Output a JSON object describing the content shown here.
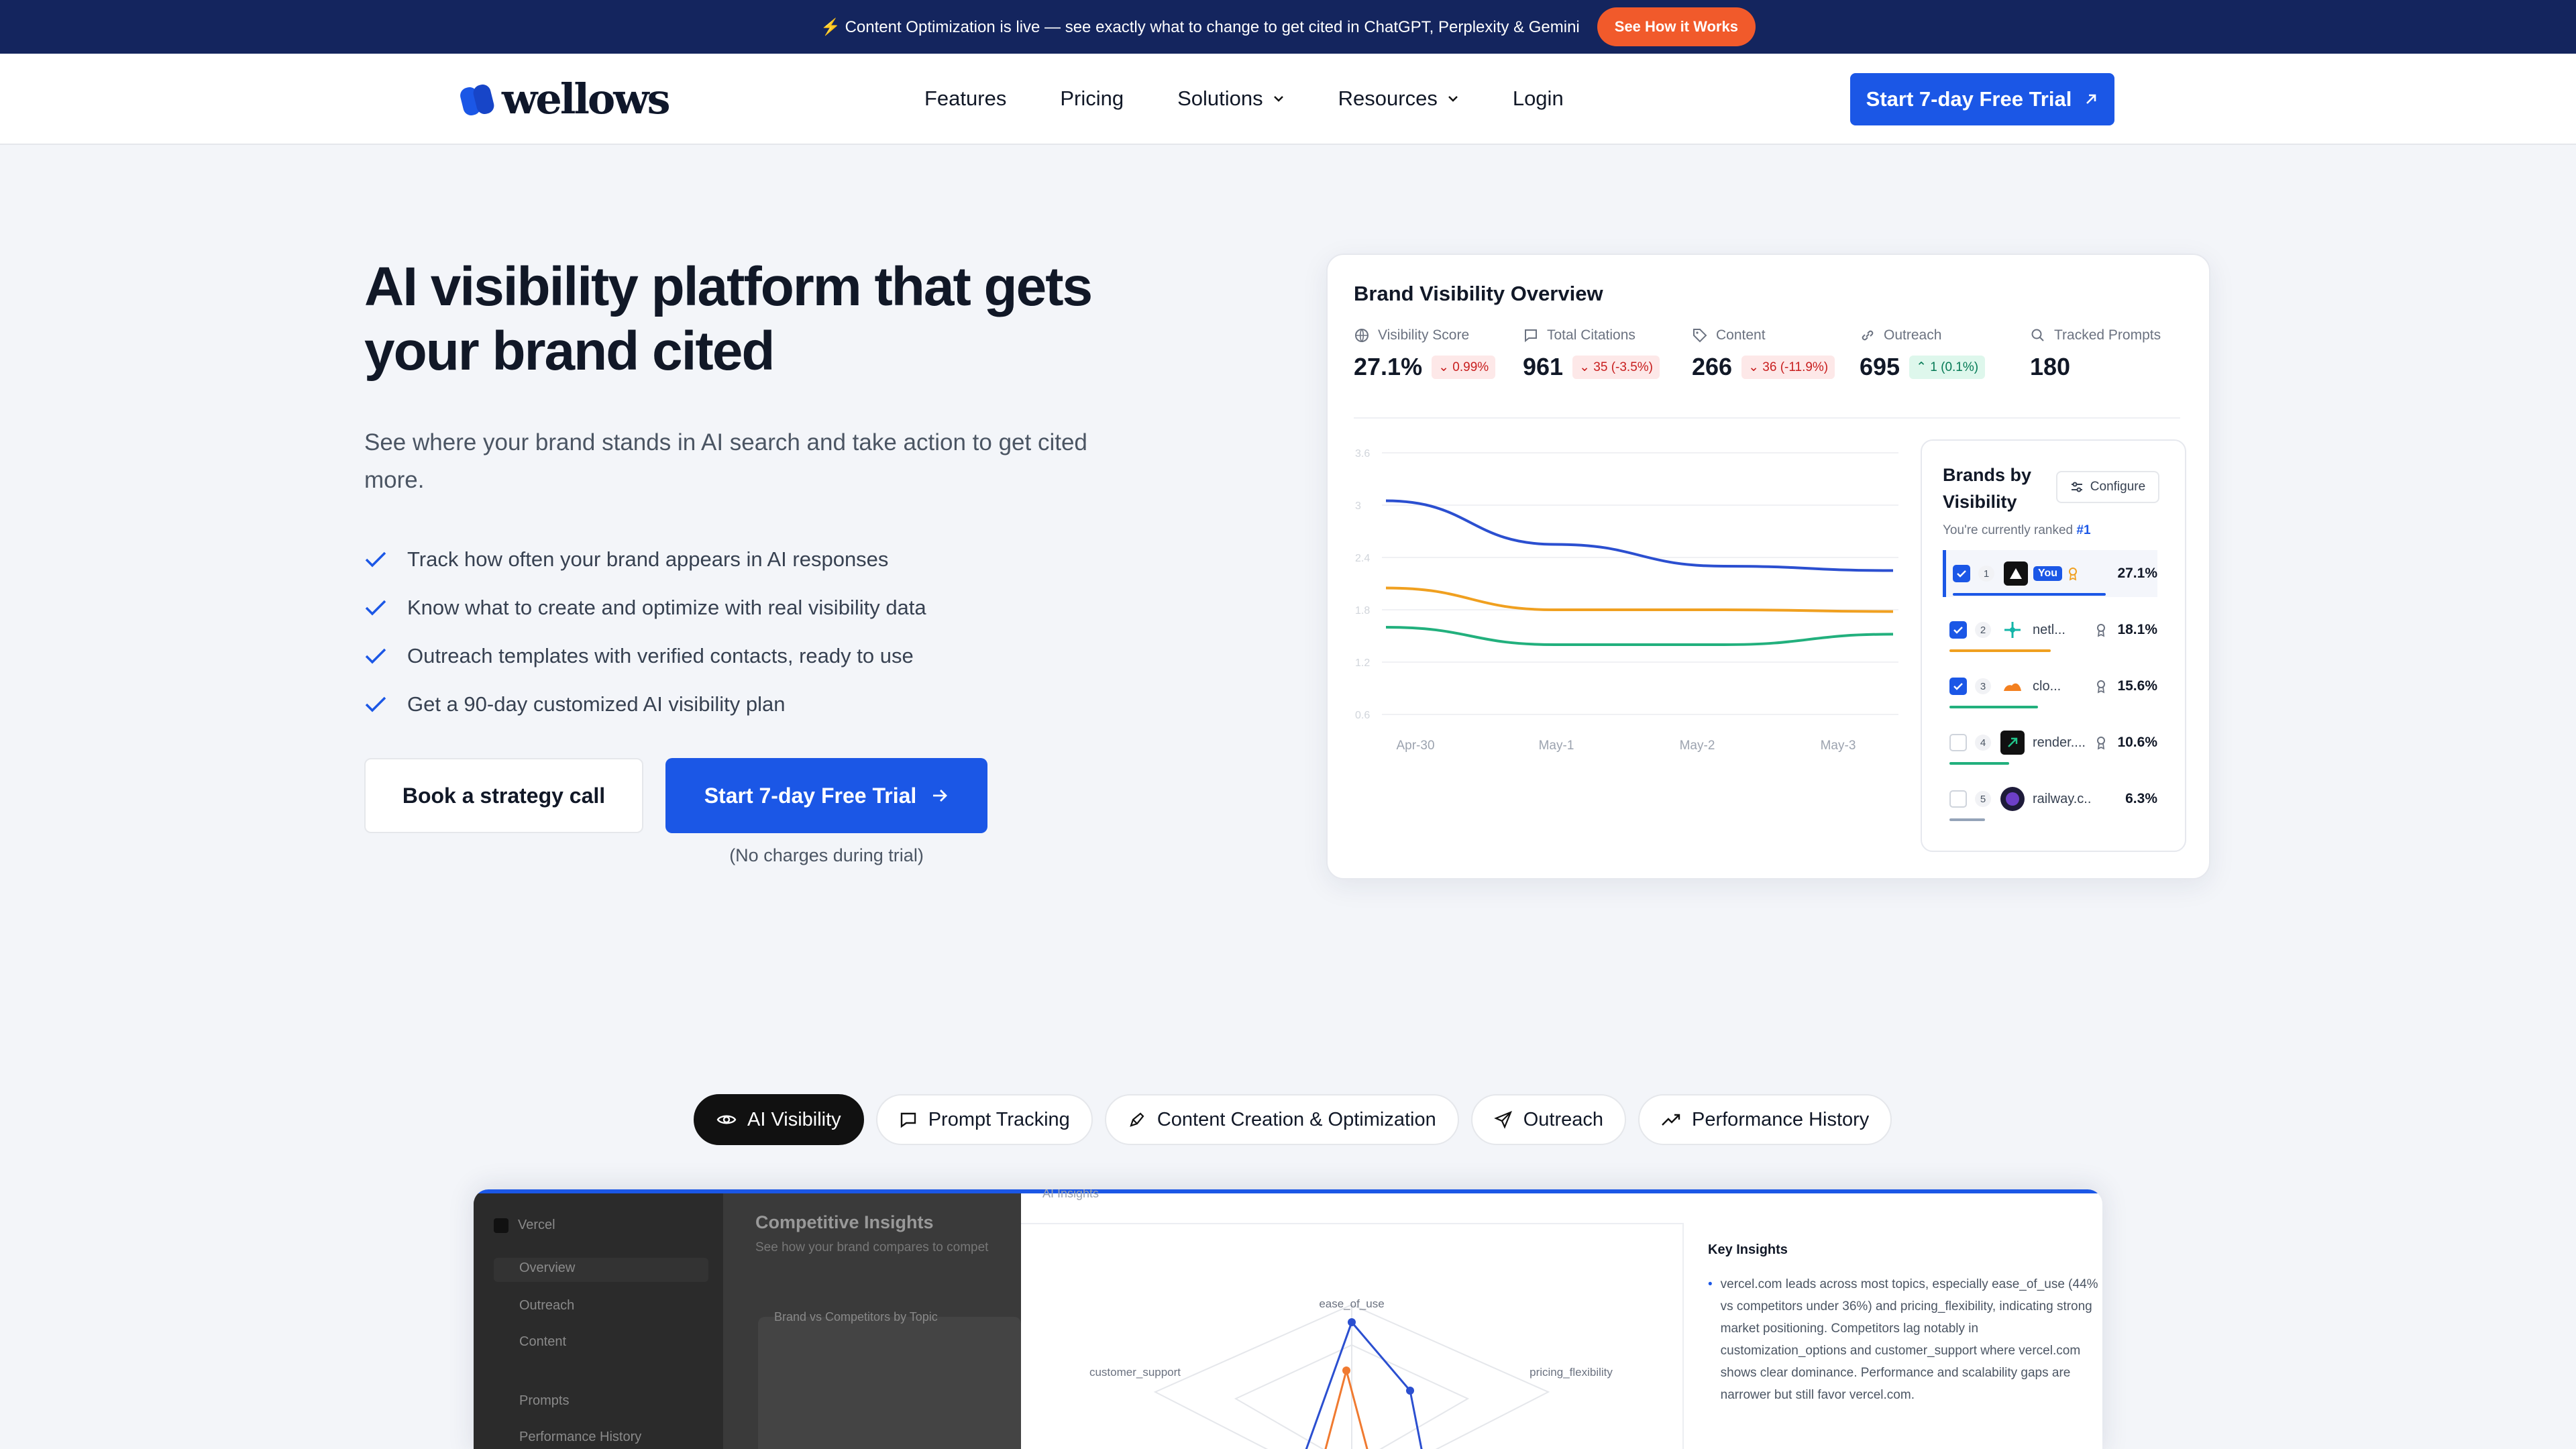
{
  "announcement": {
    "icon": "lightning-icon",
    "text": "⚡ Content Optimization is live — see exactly what to change to get cited in ChatGPT, Perplexity & Gemini",
    "button": "See How it Works"
  },
  "nav": {
    "logo": "wellows",
    "links": [
      "Features",
      "Pricing",
      "Solutions",
      "Resources",
      "Login"
    ],
    "cta": "Start 7-day Free Trial"
  },
  "hero": {
    "title": "AI visibility platform that gets your brand cited",
    "lead": "See where your brand stands in AI search and take action to get cited more.",
    "features": [
      "Track how often your brand appears in AI responses",
      "Know what to create and optimize with real visibility data",
      "Outreach templates with verified contacts, ready to use",
      "Get a 90-day customized AI visibility plan"
    ],
    "btn_call": "Book a strategy call",
    "btn_trial": "Start 7-day Free Trial",
    "note": "(No charges during trial)"
  },
  "overview": {
    "title": "Brand Visibility Overview",
    "metrics": [
      {
        "label": "Visibility Score",
        "value": "27.1%",
        "delta": "0.99%",
        "trend": "down",
        "icon": "globe-icon"
      },
      {
        "label": "Total Citations",
        "value": "961",
        "delta": "35 (-3.5%)",
        "trend": "down",
        "icon": "message-icon"
      },
      {
        "label": "Content",
        "value": "266",
        "delta": "36 (-11.9%)",
        "trend": "down",
        "icon": "tag-icon"
      },
      {
        "label": "Outreach",
        "value": "695",
        "delta": "1 (0.1%)",
        "trend": "up",
        "icon": "link-icon"
      },
      {
        "label": "Tracked Prompts",
        "value": "180",
        "delta": "",
        "trend": "",
        "icon": "search-icon"
      }
    ]
  },
  "chart_data": {
    "type": "line",
    "x": [
      "Apr-30",
      "May-1",
      "May-2",
      "May-3"
    ],
    "y_ticks": [
      "3.6",
      "3",
      "2.4",
      "1.8",
      "1.2",
      "0.6"
    ],
    "series": [
      {
        "color": "#2b4fd0",
        "values": [
          3.05,
          2.55,
          2.3,
          2.25
        ]
      },
      {
        "color": "#f0a020",
        "values": [
          2.05,
          1.8,
          1.8,
          1.78
        ]
      },
      {
        "color": "#22b07d",
        "values": [
          1.6,
          1.4,
          1.4,
          1.52
        ]
      }
    ]
  },
  "brands": {
    "title": "Brands by Visibility",
    "configure": "Configure",
    "ranked_text": "You're currently ranked",
    "ranked_value": "#1",
    "you_label": "You",
    "rows": [
      {
        "rank": "1",
        "name": "",
        "pct": "27.1%",
        "checked": true,
        "logo_color": "#111111",
        "bar_color": "#1b57e6",
        "level": 0.95
      },
      {
        "rank": "2",
        "name": "netl...",
        "pct": "18.1%",
        "checked": true,
        "logo_color": "#13b5a8",
        "bar_color": "#f0a020",
        "level": 0.63
      },
      {
        "rank": "3",
        "name": "clo...",
        "pct": "15.6%",
        "checked": true,
        "logo_color": "#f38020",
        "bar_color": "#22b07d",
        "level": 0.55
      },
      {
        "rank": "4",
        "name": "render....",
        "pct": "10.6%",
        "checked": false,
        "logo_color": "#111111",
        "bar_color": "#22b07d",
        "level": 0.37
      },
      {
        "rank": "5",
        "name": "railway.c...",
        "pct": "6.3%",
        "checked": false,
        "logo_color": "#1e1b3a",
        "bar_color": "#94a3b8",
        "level": 0.22
      }
    ]
  },
  "tabs": [
    {
      "label": "AI Visibility",
      "icon": "eye-icon"
    },
    {
      "label": "Prompt Tracking",
      "icon": "chat-icon"
    },
    {
      "label": "Content Creation & Optimization",
      "icon": "pen-icon"
    },
    {
      "label": "Outreach",
      "icon": "send-icon"
    },
    {
      "label": "Performance History",
      "icon": "trend-icon"
    }
  ],
  "preview": {
    "workspace": "Vercel",
    "sidebar": [
      "Overview",
      "Outreach",
      "Content",
      "Prompts",
      "Performance History"
    ],
    "heading": "Competitive Insights",
    "subheading": "See how your brand compares to compet",
    "panel_title": "Brand vs Competitors by Topic",
    "ai_insights": "AI Insights",
    "radar_labels": [
      "ease_of_use",
      "customer_support",
      "pricing_flexibility"
    ],
    "key_title": "Key Insights",
    "key_text": "vercel.com leads across most topics, especially ease_of_use (44% vs competitors under 36%) and pricing_flexibility, indicating strong market positioning. Competitors lag notably in customization_options and customer_support where vercel.com shows clear dominance. Performance and scalability gaps are narrower but still favor vercel.com."
  }
}
